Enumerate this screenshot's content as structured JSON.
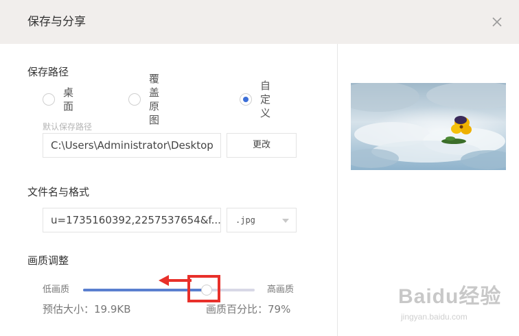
{
  "dialog": {
    "title": "保存与分享",
    "close_icon": "close-icon"
  },
  "save_path": {
    "section_title": "保存路径",
    "options": [
      {
        "label": "桌面",
        "checked": false
      },
      {
        "label": "覆盖原图",
        "checked": false
      },
      {
        "label": "自定义",
        "checked": true
      }
    ],
    "default_path_label": "默认保存路径",
    "path_value": "C:\\Users\\Administrator\\Desktop",
    "change_button": "更改"
  },
  "file": {
    "section_title": "文件名与格式",
    "filename_value": "u=1735160392,2257537654&f...",
    "format_value": ".jpg"
  },
  "quality": {
    "section_title": "画质调整",
    "low_label": "低画质",
    "high_label": "高画质",
    "level": 0.72,
    "estimated_size_label": "预估大小：19.9KB",
    "percent_label": "画质百分比：79%"
  },
  "preview": {
    "image_desc_icon": "photo-preview"
  },
  "watermark": {
    "text": "Baidu经验",
    "sub": "jingyan.baidu.com"
  },
  "colors": {
    "accent": "#3d6fd8",
    "slider_fill": "#5a7fcf",
    "highlight": "#e8302a",
    "titlebar_bg": "#f1eeec"
  }
}
